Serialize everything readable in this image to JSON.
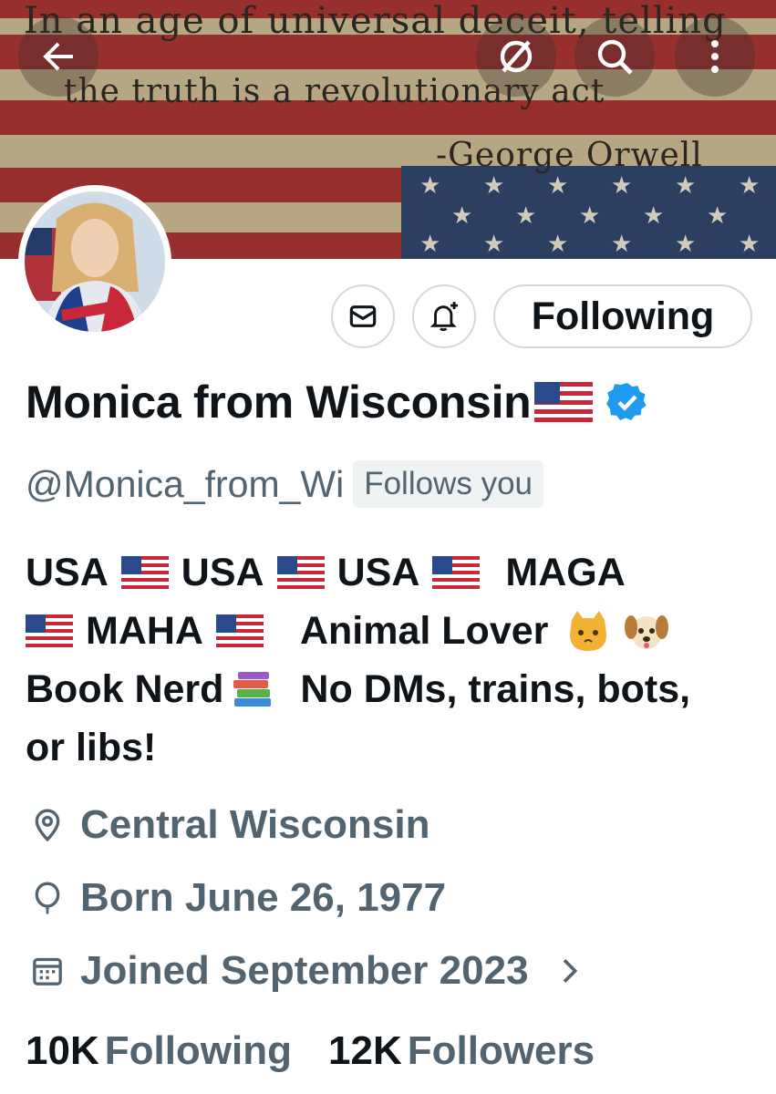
{
  "banner": {
    "quote_line1": "In an age of universal deceit, telling",
    "quote_line2": "the truth is a revolutionary act",
    "quote_line3": "-George Orwell"
  },
  "header_icons": [
    "back-arrow-icon",
    "grok-icon",
    "search-icon",
    "more-vertical-icon"
  ],
  "profile": {
    "display_name": "Monica from Wisconsin",
    "handle": "@Monica_from_Wi",
    "follows_you": "Follows you",
    "bio": {
      "line1": [
        "USA",
        "USA",
        "USA",
        "MAGA"
      ],
      "line2_a": "MAHA",
      "line2_b": "Animal Lover",
      "line3_a": "Book Nerd",
      "line3_b": "No DMs, trains, bots,",
      "line4": "or libs!"
    },
    "location": "Central Wisconsin",
    "birthday": "Born June 26, 1977",
    "joined": "Joined September 2023",
    "following_count": "10K",
    "following_label": "Following",
    "followers_count": "12K",
    "followers_label": "Followers"
  },
  "actions": {
    "following_button": "Following"
  },
  "colors": {
    "verified": "#1d9bf0",
    "muted_text": "#536471",
    "border": "#cfd9de",
    "flag_red": "#a3262c",
    "flag_blue": "#1f3a68"
  }
}
